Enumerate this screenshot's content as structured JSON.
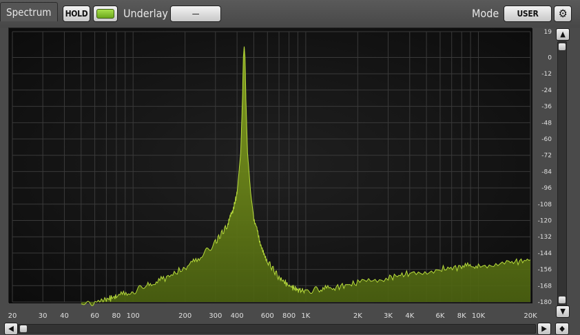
{
  "toolbar": {
    "tab_label": "Spectrum",
    "hold_label": "HOLD",
    "underlay_label": "Underlay",
    "underlay_value": "—",
    "mode_label": "Mode",
    "mode_value": "USER",
    "gear_icon": "gear-icon"
  },
  "scrollbars": {
    "up_icon": "▲",
    "down_icon": "▼",
    "left_icon": "◀",
    "right_icon": "▶",
    "corner_icon": "◆"
  },
  "colors": {
    "spectrum_fill": "#6e8a18",
    "spectrum_line": "#b8dc3c",
    "led_green": "#8cc832"
  },
  "chart_data": {
    "type": "area",
    "title": "",
    "xlabel": "",
    "ylabel": "",
    "x_scale": "log",
    "xlim": [
      20,
      20000
    ],
    "ylim": [
      -180,
      19
    ],
    "x_ticks": [
      {
        "v": 20,
        "label": "20"
      },
      {
        "v": 30,
        "label": "30"
      },
      {
        "v": 40,
        "label": "40"
      },
      {
        "v": 60,
        "label": "60"
      },
      {
        "v": 80,
        "label": "80"
      },
      {
        "v": 100,
        "label": "100"
      },
      {
        "v": 200,
        "label": "200"
      },
      {
        "v": 300,
        "label": "300"
      },
      {
        "v": 400,
        "label": "400"
      },
      {
        "v": 600,
        "label": "600"
      },
      {
        "v": 800,
        "label": "800"
      },
      {
        "v": 1000,
        "label": "1K"
      },
      {
        "v": 2000,
        "label": "2K"
      },
      {
        "v": 3000,
        "label": "3K"
      },
      {
        "v": 4000,
        "label": "4K"
      },
      {
        "v": 6000,
        "label": "6K"
      },
      {
        "v": 8000,
        "label": "8K"
      },
      {
        "v": 10000,
        "label": "10K"
      },
      {
        "v": 20000,
        "label": "20K"
      }
    ],
    "y_ticks": [
      {
        "v": 19,
        "label": "19"
      },
      {
        "v": 0,
        "label": "0"
      },
      {
        "v": -12,
        "label": "-12"
      },
      {
        "v": -24,
        "label": "-24"
      },
      {
        "v": -36,
        "label": "-36"
      },
      {
        "v": -48,
        "label": "-48"
      },
      {
        "v": -60,
        "label": "-60"
      },
      {
        "v": -72,
        "label": "-72"
      },
      {
        "v": -84,
        "label": "-84"
      },
      {
        "v": -96,
        "label": "-96"
      },
      {
        "v": -108,
        "label": "-108"
      },
      {
        "v": -120,
        "label": "-120"
      },
      {
        "v": -132,
        "label": "-132"
      },
      {
        "v": -144,
        "label": "-144"
      },
      {
        "v": -156,
        "label": "-156"
      },
      {
        "v": -168,
        "label": "-168"
      },
      {
        "v": -180,
        "label": "-180"
      }
    ],
    "series": [
      {
        "x": [
          50,
          60,
          70,
          80,
          100,
          120,
          150,
          200,
          250,
          300,
          350,
          380,
          400,
          420,
          430,
          435,
          440,
          445,
          450,
          460,
          480,
          500,
          550,
          600,
          700,
          800,
          900,
          1000,
          1200,
          1500,
          2000,
          3000,
          4000,
          6000,
          8000,
          10000,
          15000,
          20000
        ],
        "y": [
          -182,
          -180,
          -178,
          -176,
          -172,
          -168,
          -163,
          -155,
          -146,
          -136,
          -124,
          -112,
          -100,
          -70,
          -30,
          0,
          8,
          0,
          -30,
          -70,
          -100,
          -118,
          -138,
          -150,
          -162,
          -168,
          -171,
          -172,
          -171,
          -169,
          -166,
          -162,
          -159,
          -156,
          -154,
          -153,
          -151,
          -149
        ]
      }
    ]
  }
}
